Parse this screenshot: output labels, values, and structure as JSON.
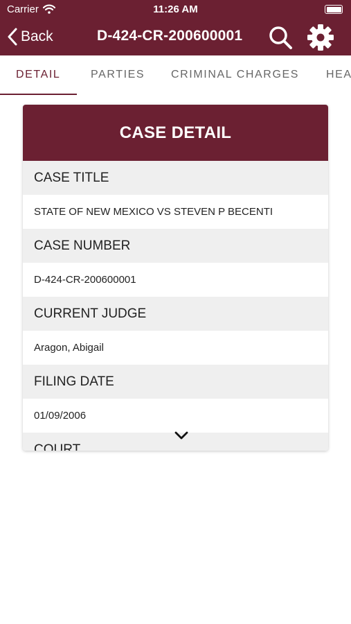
{
  "status_bar": {
    "carrier": "Carrier",
    "time": "11:26 AM"
  },
  "nav": {
    "back_label": "Back",
    "title": "D-424-CR-200600001"
  },
  "tabs": [
    {
      "label": "DETAIL",
      "active": true
    },
    {
      "label": "PARTIES",
      "active": false
    },
    {
      "label": "CRIMINAL CHARGES",
      "active": false
    },
    {
      "label": "HEA",
      "active": false
    }
  ],
  "card": {
    "header": "CASE DETAIL",
    "fields": [
      {
        "label": "CASE TITLE",
        "value": "STATE OF NEW MEXICO VS STEVEN P BECENTI"
      },
      {
        "label": "CASE NUMBER",
        "value": "D-424-CR-200600001"
      },
      {
        "label": "CURRENT JUDGE",
        "value": "Aragon, Abigail"
      },
      {
        "label": "FILING DATE",
        "value": "01/09/2006"
      },
      {
        "label": "COURT"
      }
    ]
  },
  "colors": {
    "accent": "#6b2032",
    "label_bg": "#efefef",
    "tab_inactive": "#666666"
  },
  "icons": [
    "wifi-icon",
    "battery-icon",
    "chevron-left-icon",
    "search-icon",
    "gear-icon",
    "chevron-down-icon"
  ]
}
